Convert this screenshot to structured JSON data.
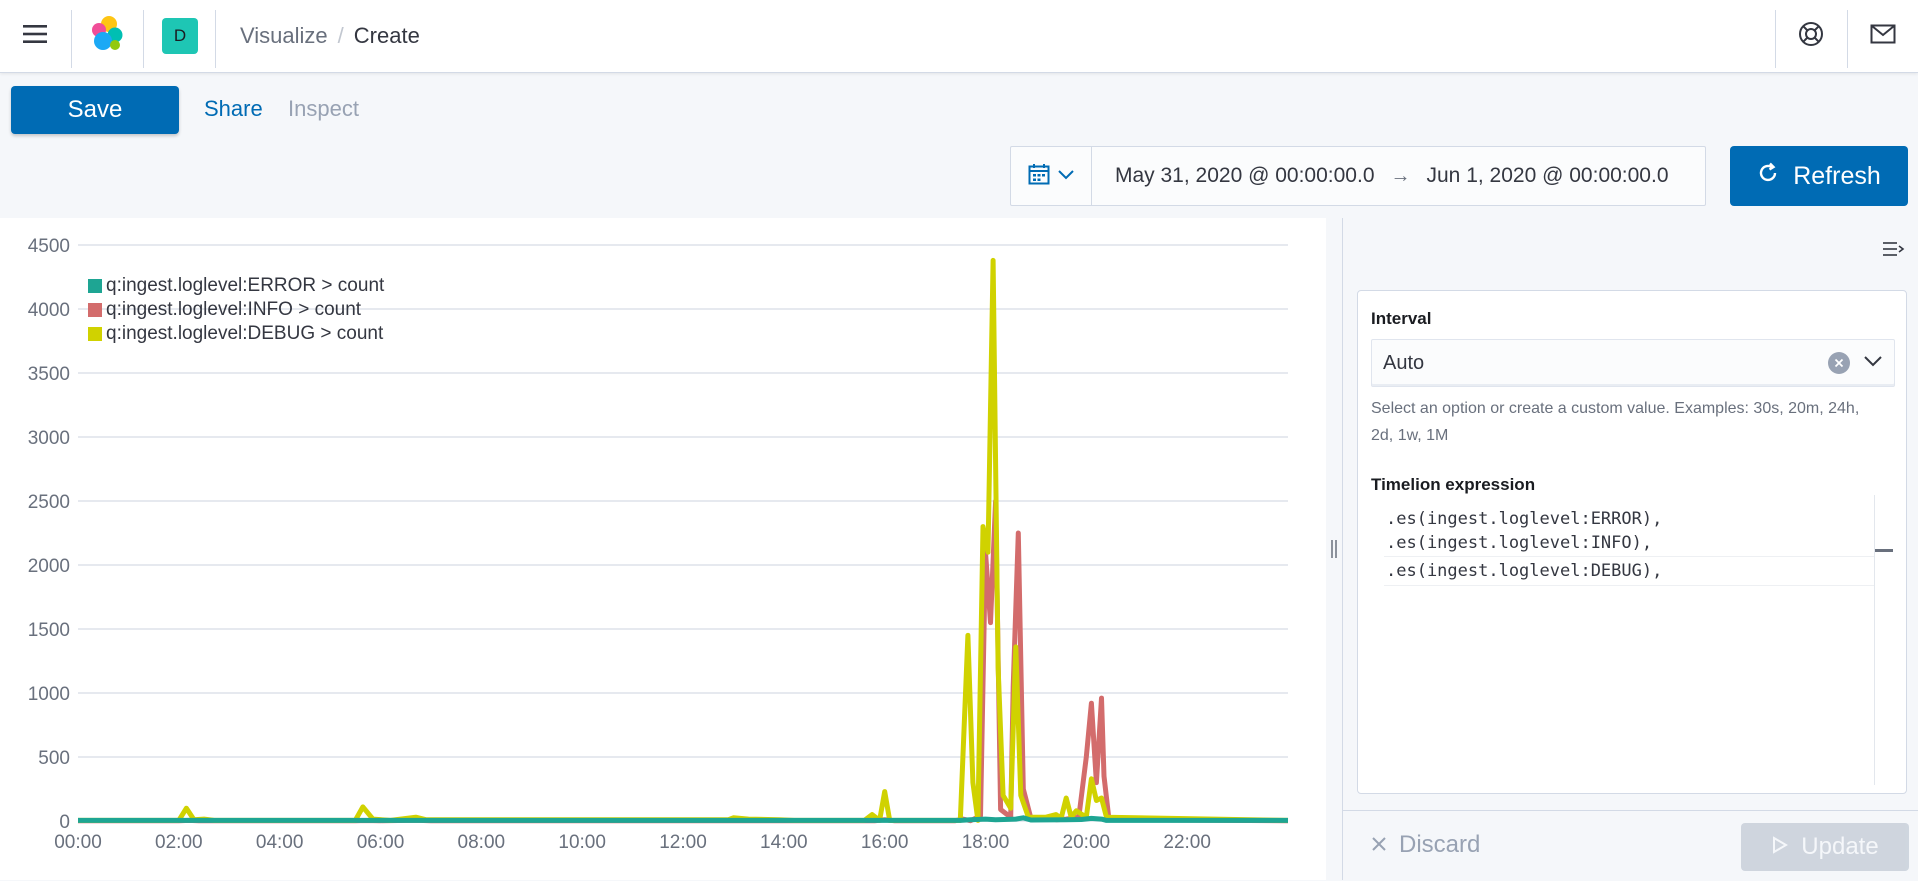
{
  "header": {
    "menu_icon": "hamburger-menu-icon",
    "logo_icon": "kibana-cluster-logo",
    "space_initial": "D",
    "breadcrumbs": {
      "parent": "Visualize",
      "separator": "/",
      "current": "Create"
    },
    "help_icon": "lifebuoy-icon",
    "mail_icon": "envelope-icon"
  },
  "top_nav": {
    "save_label": "Save",
    "share_label": "Share",
    "inspect_label": "Inspect"
  },
  "date_picker": {
    "start": "May 31, 2020 @ 00:00:00.0",
    "arrow": "→",
    "end": "Jun 1, 2020 @ 00:00:00.0",
    "refresh_label": "Refresh"
  },
  "editor": {
    "interval_label": "Interval",
    "interval_value": "Auto",
    "interval_help": "Select an option or create a custom value. Examples: 30s, 20m, 24h, 2d, 1w, 1M",
    "expression_label": "Timelion expression",
    "expression_lines": [
      ".es(ingest.loglevel:ERROR),",
      ".es(ingest.loglevel:INFO),",
      ".es(ingest.loglevel:DEBUG),"
    ],
    "discard_label": "Discard",
    "update_label": "Update"
  },
  "colors": {
    "accent": "#006bb4",
    "series_error": "#1ea593",
    "series_info": "#d36c6c",
    "series_debug": "#d0d200"
  },
  "chart_data": {
    "type": "line",
    "title": "",
    "xlabel": "",
    "ylabel": "",
    "xlim": [
      0,
      24
    ],
    "ylim": [
      0,
      4500
    ],
    "yticks": [
      0,
      500,
      1000,
      1500,
      2000,
      2500,
      3000,
      3500,
      4000,
      4500
    ],
    "xtick_labels": [
      "00:00",
      "02:00",
      "04:00",
      "06:00",
      "08:00",
      "10:00",
      "12:00",
      "14:00",
      "16:00",
      "18:00",
      "20:00",
      "22:00"
    ],
    "grid": true,
    "legend_position": "top-left",
    "series": [
      {
        "name": "q:ingest.loglevel:ERROR > count",
        "color": "#1ea593",
        "points": [
          [
            0,
            5
          ],
          [
            17.5,
            5
          ],
          [
            17.7,
            10
          ],
          [
            18.0,
            15
          ],
          [
            18.2,
            10
          ],
          [
            18.6,
            15
          ],
          [
            18.75,
            25
          ],
          [
            18.9,
            8
          ],
          [
            19.6,
            10
          ],
          [
            19.9,
            12
          ],
          [
            20.1,
            20
          ],
          [
            20.3,
            15
          ],
          [
            20.4,
            5
          ],
          [
            24,
            5
          ]
        ]
      },
      {
        "name": "q:ingest.loglevel:INFO > count",
        "color": "#d36c6c",
        "points": [
          [
            0,
            2
          ],
          [
            2.0,
            2
          ],
          [
            2.2,
            5
          ],
          [
            2.4,
            2
          ],
          [
            5.5,
            2
          ],
          [
            5.7,
            4
          ],
          [
            6.0,
            2
          ],
          [
            6.7,
            6
          ],
          [
            7.0,
            2
          ],
          [
            15.8,
            2
          ],
          [
            16.0,
            10
          ],
          [
            16.2,
            2
          ],
          [
            17.4,
            2
          ],
          [
            17.55,
            15
          ],
          [
            17.7,
            2
          ],
          [
            17.9,
            40
          ],
          [
            18.0,
            2100
          ],
          [
            18.1,
            1550
          ],
          [
            18.2,
            2500
          ],
          [
            18.3,
            90
          ],
          [
            18.5,
            30
          ],
          [
            18.55,
            1050
          ],
          [
            18.65,
            2250
          ],
          [
            18.75,
            250
          ],
          [
            18.9,
            20
          ],
          [
            19.3,
            15
          ],
          [
            19.4,
            10
          ],
          [
            19.6,
            15
          ],
          [
            19.7,
            20
          ],
          [
            19.85,
            30
          ],
          [
            20.0,
            500
          ],
          [
            20.1,
            920
          ],
          [
            20.2,
            300
          ],
          [
            20.3,
            960
          ],
          [
            20.35,
            350
          ],
          [
            20.45,
            10
          ],
          [
            24,
            2
          ]
        ]
      },
      {
        "name": "q:ingest.loglevel:DEBUG > count",
        "color": "#d0d200",
        "points": [
          [
            0,
            5
          ],
          [
            2.0,
            5
          ],
          [
            2.15,
            100
          ],
          [
            2.3,
            10
          ],
          [
            2.5,
            15
          ],
          [
            2.7,
            5
          ],
          [
            5.5,
            5
          ],
          [
            5.65,
            110
          ],
          [
            5.85,
            15
          ],
          [
            6.2,
            5
          ],
          [
            6.7,
            30
          ],
          [
            6.9,
            10
          ],
          [
            12.9,
            10
          ],
          [
            13.0,
            25
          ],
          [
            13.3,
            15
          ],
          [
            13.9,
            10
          ],
          [
            14.2,
            5
          ],
          [
            15.6,
            5
          ],
          [
            15.75,
            50
          ],
          [
            15.9,
            5
          ],
          [
            16.0,
            230
          ],
          [
            16.1,
            5
          ],
          [
            17.5,
            5
          ],
          [
            17.65,
            1450
          ],
          [
            17.75,
            300
          ],
          [
            17.85,
            5
          ],
          [
            17.95,
            2300
          ],
          [
            18.05,
            2100
          ],
          [
            18.15,
            4380
          ],
          [
            18.25,
            1200
          ],
          [
            18.35,
            200
          ],
          [
            18.5,
            100
          ],
          [
            18.6,
            1360
          ],
          [
            18.7,
            200
          ],
          [
            18.85,
            30
          ],
          [
            19.2,
            30
          ],
          [
            19.4,
            50
          ],
          [
            19.5,
            20
          ],
          [
            19.6,
            180
          ],
          [
            19.7,
            30
          ],
          [
            19.8,
            80
          ],
          [
            20.0,
            30
          ],
          [
            20.1,
            330
          ],
          [
            20.2,
            160
          ],
          [
            20.3,
            180
          ],
          [
            20.4,
            30
          ],
          [
            24,
            5
          ]
        ]
      }
    ]
  }
}
